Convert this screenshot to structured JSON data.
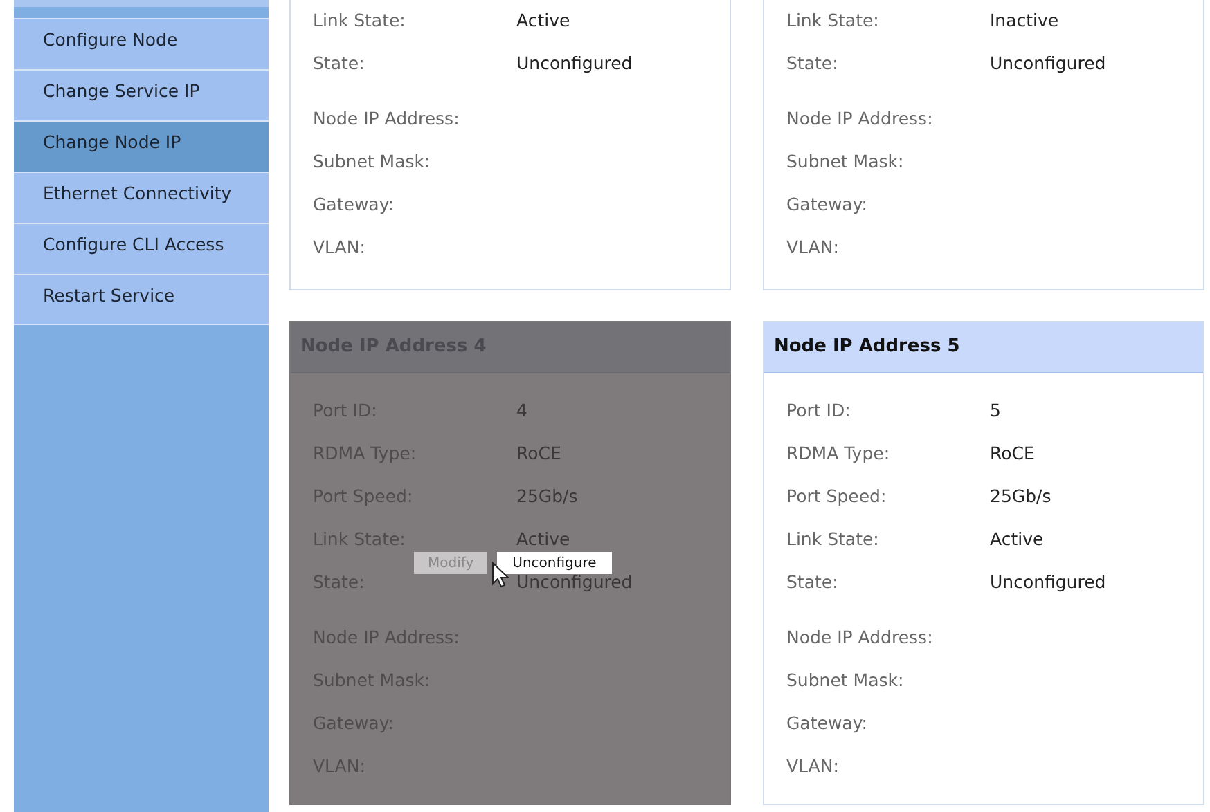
{
  "sidebar": {
    "items": [
      {
        "label": "Configure Node",
        "selected": false
      },
      {
        "label": "Change Service IP",
        "selected": false
      },
      {
        "label": "Change Node IP",
        "selected": true
      },
      {
        "label": "Ethernet Connectivity",
        "selected": false
      },
      {
        "label": "Configure CLI Access",
        "selected": false
      },
      {
        "label": "Restart Service",
        "selected": false
      }
    ]
  },
  "cards": [
    {
      "hovered": false,
      "status_rows": [
        {
          "label": "Link State:",
          "value": "Active"
        },
        {
          "label": "State:",
          "value": "Unconfigured"
        }
      ],
      "ip_rows": [
        {
          "label": "Node IP Address:"
        },
        {
          "label": "Subnet Mask:"
        },
        {
          "label": "Gateway:"
        },
        {
          "label": "VLAN:"
        }
      ]
    },
    {
      "hovered": false,
      "status_rows": [
        {
          "label": "Link State:",
          "value": "Inactive"
        },
        {
          "label": "State:",
          "value": "Unconfigured"
        }
      ],
      "ip_rows": [
        {
          "label": "Node IP Address:"
        },
        {
          "label": "Subnet Mask:"
        },
        {
          "label": "Gateway:"
        },
        {
          "label": "VLAN:"
        }
      ]
    },
    {
      "title": "Node IP Address 4",
      "hovered": true,
      "status_rows": [
        {
          "label": "Port ID:",
          "value": "4"
        },
        {
          "label": "RDMA Type:",
          "value": "RoCE"
        },
        {
          "label": "Port Speed:",
          "value": "25Gb/s"
        },
        {
          "label": "Link State:",
          "value": "Active"
        },
        {
          "label": "State:",
          "value": "Unconfigured"
        }
      ],
      "ip_rows": [
        {
          "label": "Node IP Address:"
        },
        {
          "label": "Subnet Mask:"
        },
        {
          "label": "Gateway:"
        },
        {
          "label": "VLAN:"
        }
      ],
      "actions": [
        {
          "label": "Modify",
          "highlighted": false
        },
        {
          "label": "Unconfigure",
          "highlighted": true
        }
      ]
    },
    {
      "title": "Node IP Address 5",
      "hovered": false,
      "status_rows": [
        {
          "label": "Port ID:",
          "value": "5"
        },
        {
          "label": "RDMA Type:",
          "value": "RoCE"
        },
        {
          "label": "Port Speed:",
          "value": "25Gb/s"
        },
        {
          "label": "Link State:",
          "value": "Active"
        },
        {
          "label": "State:",
          "value": "Unconfigured"
        }
      ],
      "ip_rows": [
        {
          "label": "Node IP Address:"
        },
        {
          "label": "Subnet Mask:"
        },
        {
          "label": "Gateway:"
        },
        {
          "label": "VLAN:"
        }
      ]
    }
  ]
}
